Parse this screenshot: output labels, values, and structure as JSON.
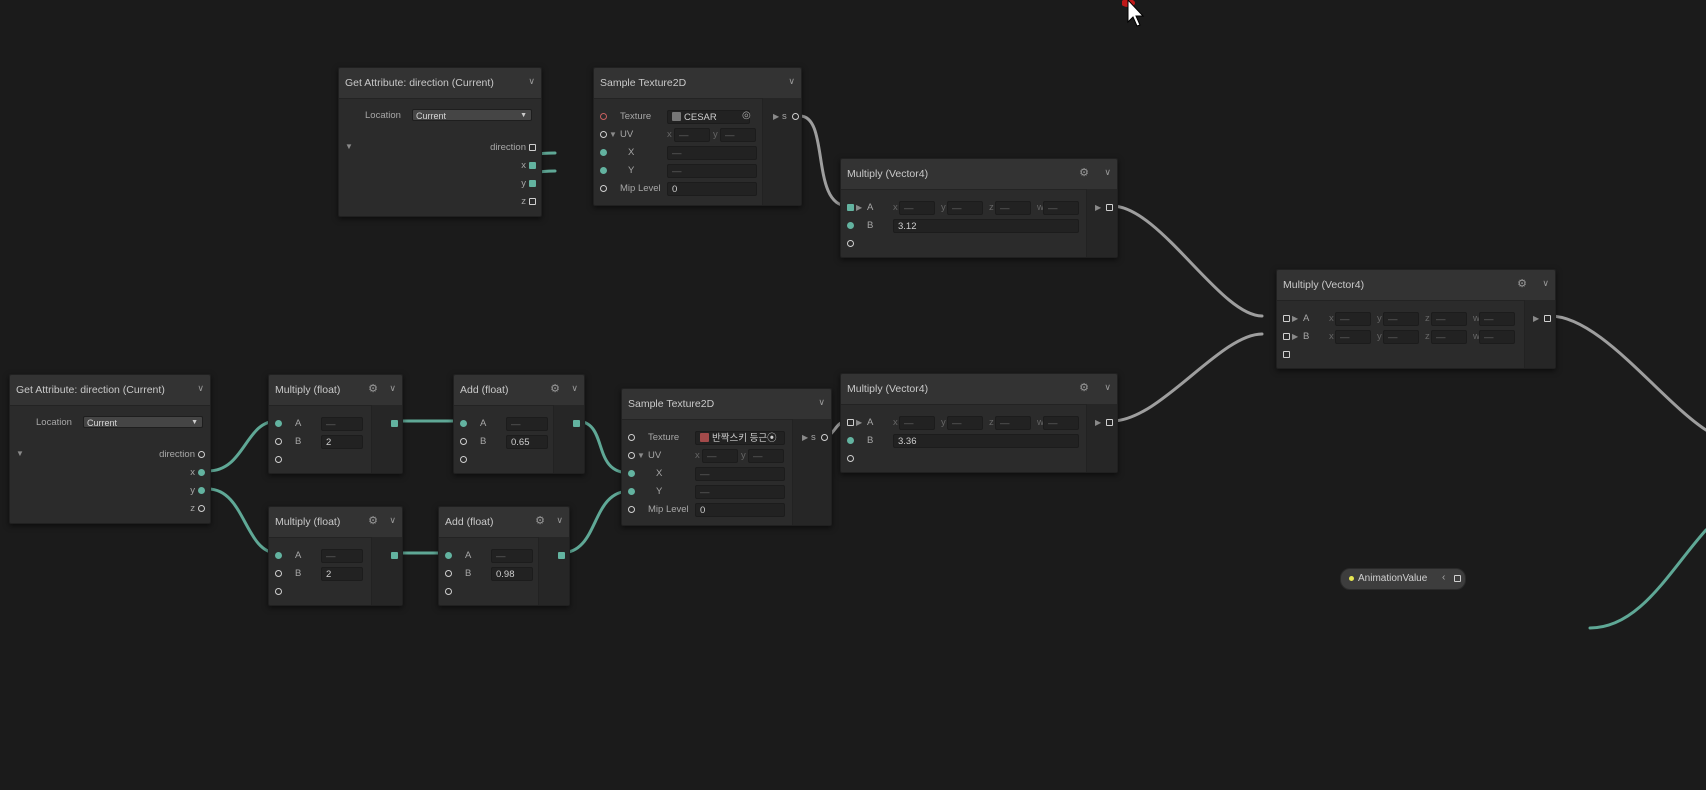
{
  "graph": {
    "getattr_top": {
      "title": "Get Attribute: direction (Current)",
      "location_label": "Location",
      "location_value": "Current",
      "out_direction": "direction",
      "out_x": "x",
      "out_y": "y",
      "out_z": "z"
    },
    "sample_top": {
      "title": "Sample Texture2D",
      "texture_label": "Texture",
      "texture_value": "CESAR",
      "uv_label": "UV",
      "uv_x_field": "x",
      "uv_y_field": "y",
      "x_label": "X",
      "y_label": "Y",
      "mip_label": "Mip Level",
      "mip_value": "0",
      "out_s": "s"
    },
    "mul_vec_top": {
      "title": "Multiply (Vector4)",
      "a_label": "A",
      "b_label": "B",
      "b_value": "3.12",
      "f_x": "x",
      "f_y": "y",
      "f_z": "z",
      "f_w": "w"
    },
    "getattr_bottom": {
      "title": "Get Attribute: direction (Current)",
      "location_label": "Location",
      "location_value": "Current",
      "out_direction": "direction",
      "out_x": "x",
      "out_y": "y",
      "out_z": "z"
    },
    "mul_float_1": {
      "title": "Multiply (float)",
      "a_label": "A",
      "b_label": "B",
      "b_value": "2",
      "a_value": "—"
    },
    "mul_float_2": {
      "title": "Multiply (float)",
      "a_label": "A",
      "b_label": "B",
      "b_value": "2",
      "a_value": "—"
    },
    "add_float_1": {
      "title": "Add (float)",
      "a_label": "A",
      "b_label": "B",
      "b_value": "0.65",
      "a_value": "—"
    },
    "add_float_2": {
      "title": "Add (float)",
      "a_label": "A",
      "b_label": "B",
      "b_value": "0.98",
      "a_value": "—"
    },
    "sample_bottom": {
      "title": "Sample Texture2D",
      "texture_label": "Texture",
      "texture_value": "반짝스키 등근⦿",
      "uv_label": "UV",
      "uv_x_field": "x",
      "uv_y_field": "y",
      "x_label": "X",
      "y_label": "Y",
      "mip_label": "Mip Level",
      "mip_value": "0",
      "out_s": "s"
    },
    "mul_vec_mid": {
      "title": "Multiply (Vector4)",
      "a_label": "A",
      "b_label": "B",
      "b_value": "3.36",
      "f_x": "x",
      "f_y": "y",
      "f_z": "z",
      "f_w": "w"
    },
    "mul_vec_right": {
      "title": "Multiply (Vector4)",
      "a_label": "A",
      "b_label": "B",
      "f_x": "x",
      "f_y": "y",
      "f_z": "z",
      "f_w": "w"
    },
    "param": {
      "name": "AnimationValue"
    }
  },
  "icons": {
    "gear": "gear-icon",
    "chevron": "chevron-down-icon",
    "picker": "object-picker-icon",
    "cursor": "mouse-cursor-icon"
  },
  "colors": {
    "background": "#1b1b1b",
    "node": "#2b2b2b",
    "header": "#333333",
    "wire_active": "#63b3a0",
    "wire_neutral": "#a7a7a7",
    "param_dot": "#e6e652"
  }
}
